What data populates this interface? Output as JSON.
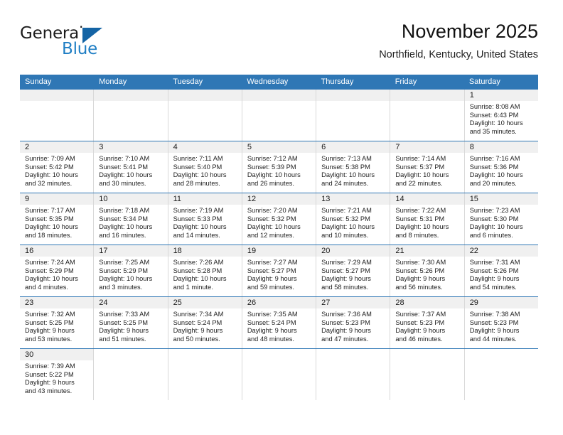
{
  "brand": {
    "name_part1": "General",
    "name_part2": "Blue"
  },
  "header": {
    "month_title": "November 2025",
    "location": "Northfield, Kentucky, United States"
  },
  "colors": {
    "header_blue": "#2f77b5",
    "logo_blue": "#1f7ec4",
    "day_band_gray": "#f0f0f0",
    "cell_border": "#d8d8d8"
  },
  "weekdays": [
    "Sunday",
    "Monday",
    "Tuesday",
    "Wednesday",
    "Thursday",
    "Friday",
    "Saturday"
  ],
  "weeks": [
    [
      {
        "day": "",
        "empty": true
      },
      {
        "day": "",
        "empty": true
      },
      {
        "day": "",
        "empty": true
      },
      {
        "day": "",
        "empty": true
      },
      {
        "day": "",
        "empty": true
      },
      {
        "day": "",
        "empty": true
      },
      {
        "day": "1",
        "sunrise": "Sunrise: 8:08 AM",
        "sunset": "Sunset: 6:43 PM",
        "daylight1": "Daylight: 10 hours",
        "daylight2": "and 35 minutes."
      }
    ],
    [
      {
        "day": "2",
        "sunrise": "Sunrise: 7:09 AM",
        "sunset": "Sunset: 5:42 PM",
        "daylight1": "Daylight: 10 hours",
        "daylight2": "and 32 minutes."
      },
      {
        "day": "3",
        "sunrise": "Sunrise: 7:10 AM",
        "sunset": "Sunset: 5:41 PM",
        "daylight1": "Daylight: 10 hours",
        "daylight2": "and 30 minutes."
      },
      {
        "day": "4",
        "sunrise": "Sunrise: 7:11 AM",
        "sunset": "Sunset: 5:40 PM",
        "daylight1": "Daylight: 10 hours",
        "daylight2": "and 28 minutes."
      },
      {
        "day": "5",
        "sunrise": "Sunrise: 7:12 AM",
        "sunset": "Sunset: 5:39 PM",
        "daylight1": "Daylight: 10 hours",
        "daylight2": "and 26 minutes."
      },
      {
        "day": "6",
        "sunrise": "Sunrise: 7:13 AM",
        "sunset": "Sunset: 5:38 PM",
        "daylight1": "Daylight: 10 hours",
        "daylight2": "and 24 minutes."
      },
      {
        "day": "7",
        "sunrise": "Sunrise: 7:14 AM",
        "sunset": "Sunset: 5:37 PM",
        "daylight1": "Daylight: 10 hours",
        "daylight2": "and 22 minutes."
      },
      {
        "day": "8",
        "sunrise": "Sunrise: 7:16 AM",
        "sunset": "Sunset: 5:36 PM",
        "daylight1": "Daylight: 10 hours",
        "daylight2": "and 20 minutes."
      }
    ],
    [
      {
        "day": "9",
        "sunrise": "Sunrise: 7:17 AM",
        "sunset": "Sunset: 5:35 PM",
        "daylight1": "Daylight: 10 hours",
        "daylight2": "and 18 minutes."
      },
      {
        "day": "10",
        "sunrise": "Sunrise: 7:18 AM",
        "sunset": "Sunset: 5:34 PM",
        "daylight1": "Daylight: 10 hours",
        "daylight2": "and 16 minutes."
      },
      {
        "day": "11",
        "sunrise": "Sunrise: 7:19 AM",
        "sunset": "Sunset: 5:33 PM",
        "daylight1": "Daylight: 10 hours",
        "daylight2": "and 14 minutes."
      },
      {
        "day": "12",
        "sunrise": "Sunrise: 7:20 AM",
        "sunset": "Sunset: 5:32 PM",
        "daylight1": "Daylight: 10 hours",
        "daylight2": "and 12 minutes."
      },
      {
        "day": "13",
        "sunrise": "Sunrise: 7:21 AM",
        "sunset": "Sunset: 5:32 PM",
        "daylight1": "Daylight: 10 hours",
        "daylight2": "and 10 minutes."
      },
      {
        "day": "14",
        "sunrise": "Sunrise: 7:22 AM",
        "sunset": "Sunset: 5:31 PM",
        "daylight1": "Daylight: 10 hours",
        "daylight2": "and 8 minutes."
      },
      {
        "day": "15",
        "sunrise": "Sunrise: 7:23 AM",
        "sunset": "Sunset: 5:30 PM",
        "daylight1": "Daylight: 10 hours",
        "daylight2": "and 6 minutes."
      }
    ],
    [
      {
        "day": "16",
        "sunrise": "Sunrise: 7:24 AM",
        "sunset": "Sunset: 5:29 PM",
        "daylight1": "Daylight: 10 hours",
        "daylight2": "and 4 minutes."
      },
      {
        "day": "17",
        "sunrise": "Sunrise: 7:25 AM",
        "sunset": "Sunset: 5:29 PM",
        "daylight1": "Daylight: 10 hours",
        "daylight2": "and 3 minutes."
      },
      {
        "day": "18",
        "sunrise": "Sunrise: 7:26 AM",
        "sunset": "Sunset: 5:28 PM",
        "daylight1": "Daylight: 10 hours",
        "daylight2": "and 1 minute."
      },
      {
        "day": "19",
        "sunrise": "Sunrise: 7:27 AM",
        "sunset": "Sunset: 5:27 PM",
        "daylight1": "Daylight: 9 hours",
        "daylight2": "and 59 minutes."
      },
      {
        "day": "20",
        "sunrise": "Sunrise: 7:29 AM",
        "sunset": "Sunset: 5:27 PM",
        "daylight1": "Daylight: 9 hours",
        "daylight2": "and 58 minutes."
      },
      {
        "day": "21",
        "sunrise": "Sunrise: 7:30 AM",
        "sunset": "Sunset: 5:26 PM",
        "daylight1": "Daylight: 9 hours",
        "daylight2": "and 56 minutes."
      },
      {
        "day": "22",
        "sunrise": "Sunrise: 7:31 AM",
        "sunset": "Sunset: 5:26 PM",
        "daylight1": "Daylight: 9 hours",
        "daylight2": "and 54 minutes."
      }
    ],
    [
      {
        "day": "23",
        "sunrise": "Sunrise: 7:32 AM",
        "sunset": "Sunset: 5:25 PM",
        "daylight1": "Daylight: 9 hours",
        "daylight2": "and 53 minutes."
      },
      {
        "day": "24",
        "sunrise": "Sunrise: 7:33 AM",
        "sunset": "Sunset: 5:25 PM",
        "daylight1": "Daylight: 9 hours",
        "daylight2": "and 51 minutes."
      },
      {
        "day": "25",
        "sunrise": "Sunrise: 7:34 AM",
        "sunset": "Sunset: 5:24 PM",
        "daylight1": "Daylight: 9 hours",
        "daylight2": "and 50 minutes."
      },
      {
        "day": "26",
        "sunrise": "Sunrise: 7:35 AM",
        "sunset": "Sunset: 5:24 PM",
        "daylight1": "Daylight: 9 hours",
        "daylight2": "and 48 minutes."
      },
      {
        "day": "27",
        "sunrise": "Sunrise: 7:36 AM",
        "sunset": "Sunset: 5:23 PM",
        "daylight1": "Daylight: 9 hours",
        "daylight2": "and 47 minutes."
      },
      {
        "day": "28",
        "sunrise": "Sunrise: 7:37 AM",
        "sunset": "Sunset: 5:23 PM",
        "daylight1": "Daylight: 9 hours",
        "daylight2": "and 46 minutes."
      },
      {
        "day": "29",
        "sunrise": "Sunrise: 7:38 AM",
        "sunset": "Sunset: 5:23 PM",
        "daylight1": "Daylight: 9 hours",
        "daylight2": "and 44 minutes."
      }
    ],
    [
      {
        "day": "30",
        "sunrise": "Sunrise: 7:39 AM",
        "sunset": "Sunset: 5:22 PM",
        "daylight1": "Daylight: 9 hours",
        "daylight2": "and 43 minutes."
      },
      {
        "day": "",
        "empty": true,
        "blank": true
      },
      {
        "day": "",
        "empty": true,
        "blank": true
      },
      {
        "day": "",
        "empty": true,
        "blank": true
      },
      {
        "day": "",
        "empty": true,
        "blank": true
      },
      {
        "day": "",
        "empty": true,
        "blank": true
      },
      {
        "day": "",
        "empty": true,
        "blank": true
      }
    ]
  ]
}
